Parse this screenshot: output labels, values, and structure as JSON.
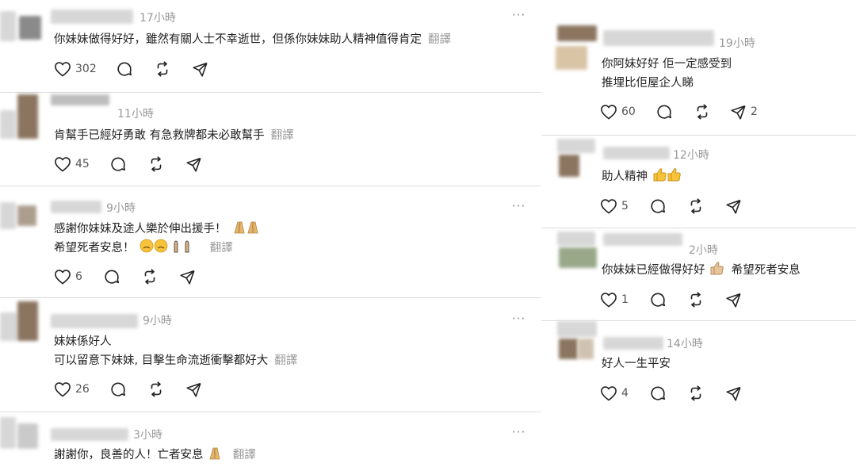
{
  "more_glyph": "···",
  "translate_label": "翻譯",
  "left_posts": [
    {
      "time": "17小時",
      "lines": [
        "你妹妹做得好好，雖然有關人士不幸逝世，但係你妹妹助人精神值得肯定"
      ],
      "likes": "302"
    },
    {
      "time": "11小時",
      "lines": [
        "肯幫手已經好勇敢 有急救牌都未必敢幫手"
      ],
      "likes": "45"
    },
    {
      "time": "9小時",
      "lines": [
        "感謝你妹妹及途人樂於伸出援手！",
        "希望死者安息！"
      ],
      "likes": "6"
    },
    {
      "time": "9小時",
      "lines": [
        "妹妹係好人",
        "可以留意下妹妹, 目擊生命流逝衝擊都好大"
      ],
      "likes": "26"
    },
    {
      "time": "3小時",
      "lines": [
        "謝謝你，良善的人！亡者安息"
      ]
    }
  ],
  "right_posts": [
    {
      "time": "19小時",
      "lines": [
        "你阿妹好好 佢一定感受到",
        "推埋比佢屋企人睇"
      ],
      "likes": "60",
      "shares": "2"
    },
    {
      "time": "12小時",
      "lines": [
        "助人精神"
      ],
      "likes": "5"
    },
    {
      "time": "2小時",
      "lines": [
        "你妹妹已經做得好好",
        "希望死者安息"
      ],
      "likes": "1"
    },
    {
      "time": "14小時",
      "lines": [
        "好人一生平安"
      ],
      "likes": "4"
    }
  ]
}
